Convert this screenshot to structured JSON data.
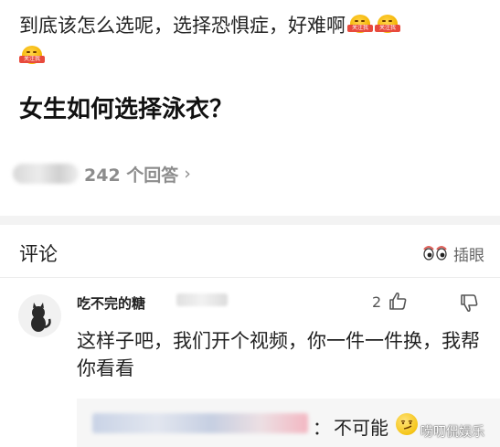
{
  "post": {
    "text": "到底该怎么选呢，选择恐惧症，好难啊",
    "emoji_label": "关注我"
  },
  "question": {
    "title": "女生如何选择泳衣？",
    "answers_count": "242 个回答",
    "chevron": "›"
  },
  "comments": {
    "header": "评论",
    "insert_label": "插眼"
  },
  "comment": {
    "username": "吃不完的糖",
    "likes": "2",
    "text": "这样子吧，我们开个视频，你一件一件换，我帮你看看",
    "reply": {
      "colon": "：",
      "text": "不可能"
    }
  },
  "watermark": "唠叨侃娱乐",
  "colors": {
    "title": "#111111",
    "muted": "#8c8c8c",
    "band": "#f3f3f3",
    "reply_bg": "#f6f6f6"
  }
}
